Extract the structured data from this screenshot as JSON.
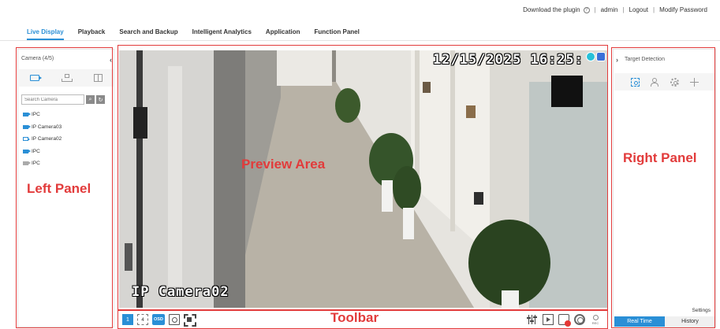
{
  "top_links": {
    "download": "Download the plugin",
    "user": "admin",
    "logout": "Logout",
    "modify_password": "Modify Password"
  },
  "nav": {
    "tabs": [
      {
        "label": "Live Display",
        "active": true
      },
      {
        "label": "Playback"
      },
      {
        "label": "Search and Backup"
      },
      {
        "label": "Intelligent Analytics"
      },
      {
        "label": "Application"
      },
      {
        "label": "Function Panel"
      }
    ]
  },
  "left_panel": {
    "header": "Camera (4/5)",
    "search_placeholder": "Search Camera",
    "cameras": [
      {
        "name": "IPC",
        "status": "online"
      },
      {
        "name": "IP Camera03",
        "status": "online"
      },
      {
        "name": "IP Camera02",
        "status": "selected"
      },
      {
        "name": "IPC",
        "status": "online"
      },
      {
        "name": "IPC",
        "status": "offline"
      }
    ]
  },
  "preview": {
    "osd_datetime": "12/15/2025 16:25:",
    "osd_camera_name": "IP Camera02"
  },
  "right_panel": {
    "header": "Target Detection",
    "settings": "Settings",
    "tab_realtime": "Real Time",
    "tab_history": "History"
  },
  "toolbar": {
    "screen_number": "1",
    "layout_label": "4",
    "osd_label": "OSD",
    "rec_label": "REC"
  },
  "annotations": {
    "left_panel": "Left Panel",
    "preview_area": "Preview Area",
    "right_panel": "Right Panel",
    "toolbar": "Toolbar"
  },
  "colors": {
    "accent": "#2a8fd6",
    "annotation": "#e23b3b"
  }
}
